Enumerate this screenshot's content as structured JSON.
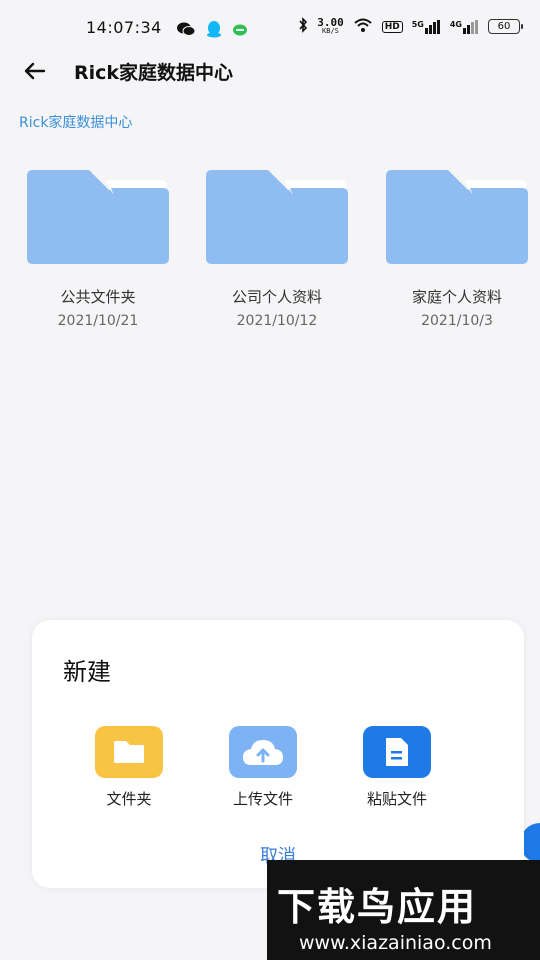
{
  "status_bar": {
    "time": "14:07:34",
    "net_speed_value": "3.00",
    "net_speed_unit": "KB/S",
    "hd_badge": "HD",
    "signal1_label": "5G",
    "signal2_label": "4G",
    "battery": "60",
    "icons": [
      "wechat-icon",
      "qq-icon",
      "message-icon",
      "bluetooth-icon",
      "wifi-icon"
    ]
  },
  "header": {
    "title": "Rick家庭数据中心"
  },
  "breadcrumb": {
    "path": "Rick家庭数据中心"
  },
  "folders": [
    {
      "name": "公共文件夹",
      "date": "2021/10/21"
    },
    {
      "name": "公司个人资料",
      "date": "2021/10/12"
    },
    {
      "name": "家庭个人资料",
      "date": "2021/10/3"
    }
  ],
  "sheet": {
    "title": "新建",
    "actions": [
      {
        "label": "文件夹",
        "icon": "folder-icon",
        "color": "#f7c443"
      },
      {
        "label": "上传文件",
        "icon": "cloud-upload-icon",
        "color": "#7db3f5"
      },
      {
        "label": "粘贴文件",
        "icon": "document-icon",
        "color": "#1f7ae8"
      }
    ],
    "cancel": "取消"
  },
  "watermark": {
    "title": "下载鸟应用",
    "url": "www.xiazainiao.com"
  },
  "colors": {
    "folder": "#8fbdf2",
    "accent": "#3b7fd8",
    "background": "#f5f5f7"
  }
}
